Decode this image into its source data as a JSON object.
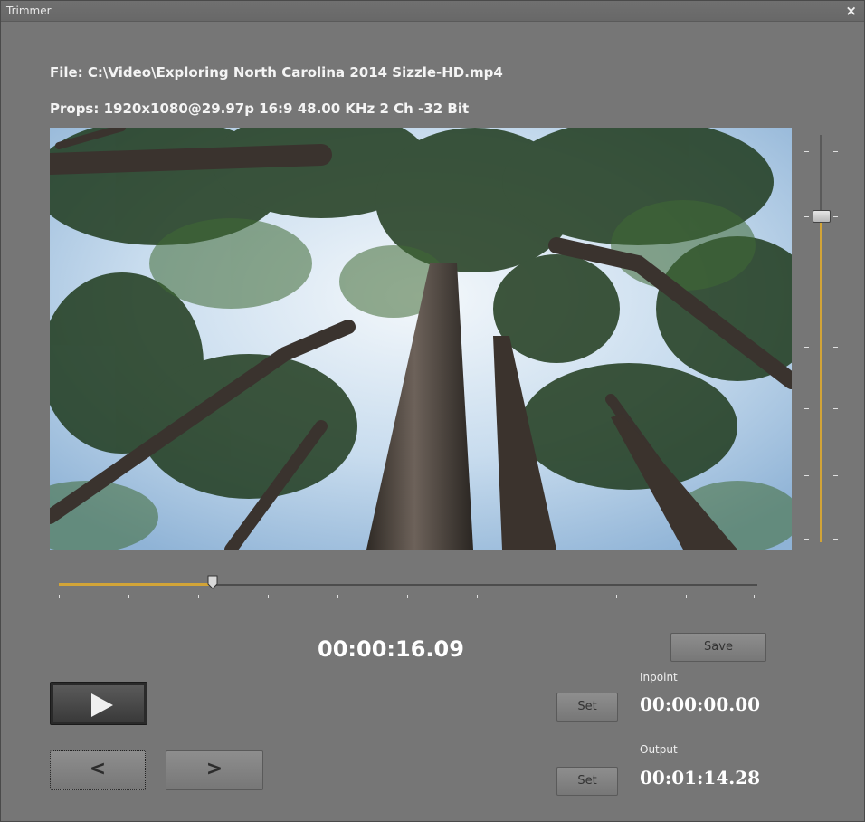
{
  "window": {
    "title": "Trimmer",
    "close_label": "×"
  },
  "file_info": {
    "file_line": "File: C:\\Video\\Exploring North Carolina 2014 Sizzle-HD.mp4",
    "props_line": "Props: 1920x1080@29.97p 16:9 48.00 KHz 2 Ch -32 Bit"
  },
  "playback": {
    "current_time": "00:00:16.09",
    "position_fraction": 0.22,
    "volume_fraction": 0.8
  },
  "controls": {
    "prev_label": "<",
    "next_label": ">",
    "save_label": "Save",
    "set_in_label": "Set",
    "set_out_label": "Set"
  },
  "inpoint": {
    "label": "Inpoint",
    "value": "00:00:00.00"
  },
  "output": {
    "label": "Output",
    "value": "00:01:14.28"
  },
  "colors": {
    "accent": "#d2a437",
    "background": "#767676"
  }
}
